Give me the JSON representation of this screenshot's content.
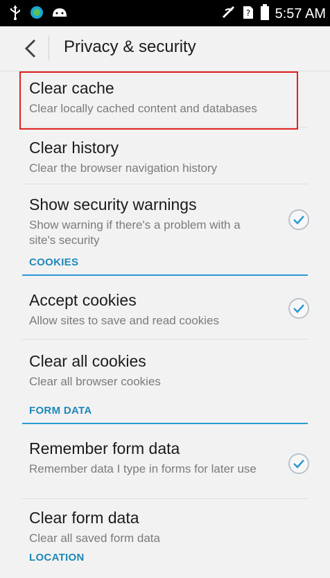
{
  "status_bar": {
    "time": "5:57 AM",
    "left_icons": [
      "usb-icon",
      "sync-icon",
      "android-icon"
    ],
    "right_icons": [
      "no-signal-icon",
      "sim-unknown-icon",
      "battery-icon"
    ]
  },
  "app_bar": {
    "back_icon": "back-chevron-icon",
    "title": "Privacy & security"
  },
  "items": [
    {
      "title": "Clear cache",
      "summary": "Clear locally cached content and databases",
      "checked": null
    },
    {
      "title": "Clear history",
      "summary": "Clear the browser navigation history",
      "checked": null
    },
    {
      "title": "Show security warnings",
      "summary": "Show warning if there's a problem with a site's security",
      "checked": true
    }
  ],
  "sections": {
    "cookies": "COOKIES",
    "form_data": "FORM DATA",
    "location": "LOCATION"
  },
  "cookies_items": [
    {
      "title": "Accept cookies",
      "summary": "Allow sites to save and read cookies",
      "checked": true
    },
    {
      "title": "Clear all cookies",
      "summary": "Clear all browser cookies",
      "checked": null
    }
  ],
  "form_items": [
    {
      "title": "Remember form data",
      "summary": "Remember data I type in forms for later use",
      "checked": true
    },
    {
      "title": "Clear form data",
      "summary": "Clear all saved form data",
      "checked": null
    }
  ],
  "colors": {
    "accent": "#2a9ad3",
    "highlight_box": "#e02020",
    "checkbox_tick": "#2a9ad3"
  }
}
